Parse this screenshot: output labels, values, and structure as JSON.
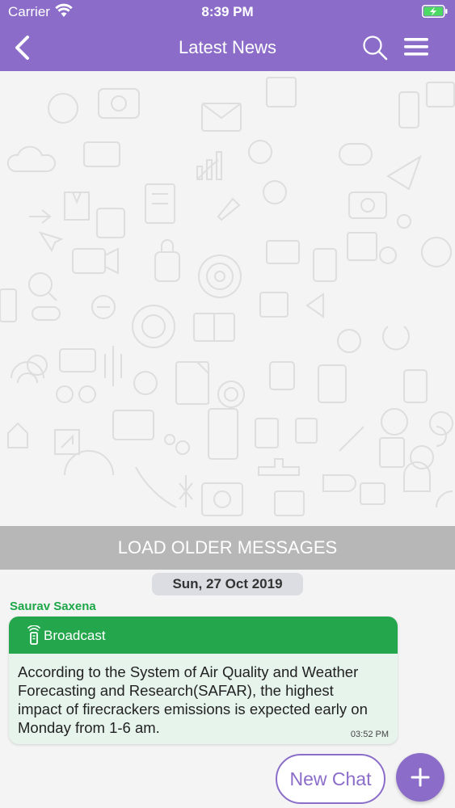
{
  "status_bar": {
    "carrier": "Carrier",
    "time": "8:39 PM"
  },
  "header": {
    "title": "Latest News",
    "icons": [
      "back-icon",
      "search-icon",
      "menu-icon"
    ]
  },
  "chat": {
    "load_older_label": "LOAD OLDER MESSAGES",
    "date_label": "Sun, 27 Oct 2019",
    "messages": [
      {
        "sender": "Saurav Saxena",
        "channel_label": "Broadcast",
        "text": "According to the System of Air Quality and Weather Forecasting and Research(SAFAR), the highest impact of firecrackers emissions is expected early on Monday from 1-6 am.",
        "time": "03:52 PM"
      }
    ]
  },
  "actions": {
    "new_chat_label": "New Chat",
    "add_icon": "plus-icon"
  },
  "colors": {
    "brand_purple": "#8b6dc9",
    "broadcast_green": "#23a64c",
    "sender_green": "#1ea748",
    "message_bg": "#e7f4ec"
  }
}
